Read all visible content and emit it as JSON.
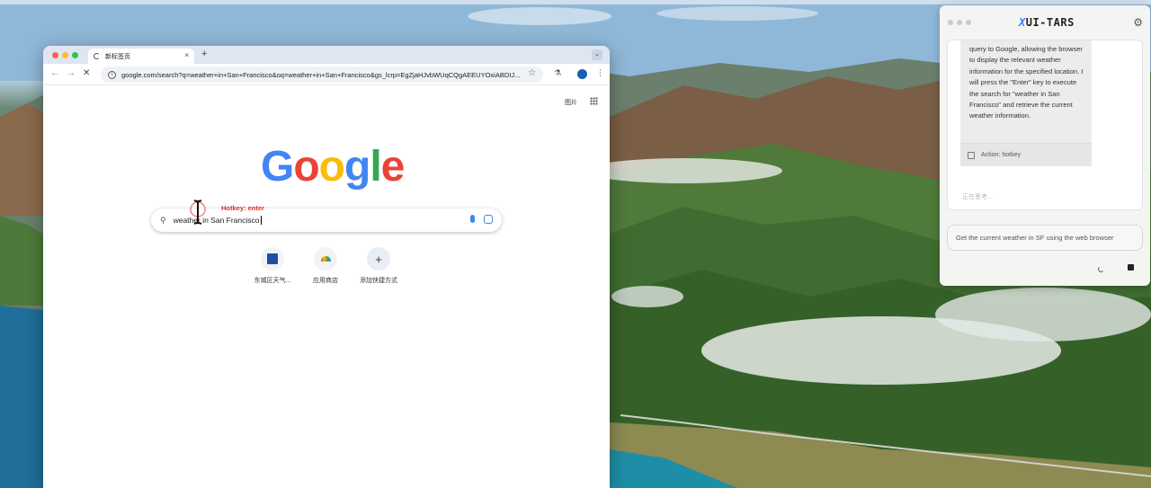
{
  "browser": {
    "tab_title": "新标签页",
    "tab_close": "×",
    "new_tab": "+",
    "tab_menu": "⌄",
    "url": "google.com/search?q=weather+in+San+Francisco&oq=weather+in+San+Francisco&gs_lcrp=EgZjaHJvbWUqCQgAEEUYOxiABDIJ...",
    "images_link": "图片"
  },
  "google": {
    "logo": [
      "G",
      "o",
      "o",
      "g",
      "l",
      "e"
    ],
    "logo_colors": [
      "#4285F4",
      "#EA4335",
      "#FBBC05",
      "#4285F4",
      "#34A853",
      "#EA4335"
    ],
    "search_query": "weather in San Francisco",
    "hotkey_label": "Hotkey: enter",
    "shortcuts": [
      {
        "label": "东城区天气..."
      },
      {
        "label": "应用商店"
      },
      {
        "label": "添加快捷方式",
        "icon": "+"
      }
    ]
  },
  "tars": {
    "title_x": "X",
    "title_rest": "UI-TARS",
    "message": "query to Google, allowing the browser to display the relevant weather information for the specified location. I will press the \"Enter\" key to execute the search for \"weather in San Francisco\" and retrieve the current weather information.",
    "action": "Action: hotkey",
    "thinking": "正在思考...",
    "task": "Get the current weather in SF using the web browser"
  },
  "colors": {
    "accent": "#3b82f6",
    "hotkey": "#d93025"
  }
}
